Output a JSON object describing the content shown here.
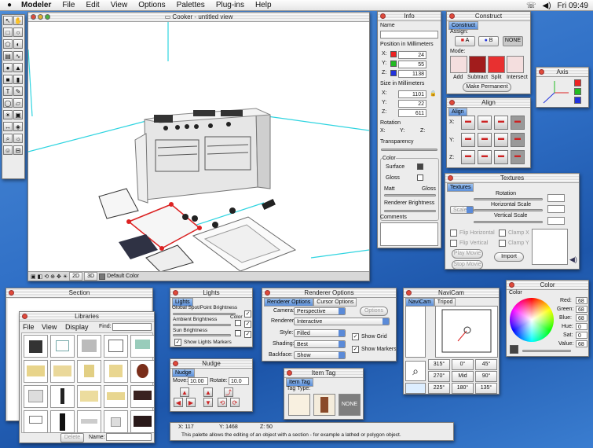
{
  "menubar": {
    "app": "Modeler",
    "items": [
      "File",
      "Edit",
      "View",
      "Options",
      "Palettes",
      "Plug-ins",
      "Help"
    ],
    "clock": "Fri 09:49"
  },
  "main_window": {
    "title": "Cooker - untitled view",
    "bottom_mode": "Default Color",
    "view_btns": [
      "2D",
      "3D"
    ]
  },
  "info": {
    "title": "Info",
    "name_label": "Name",
    "position_label": "Position in Millimeters",
    "x_label": "X:",
    "y_label": "Y:",
    "z_label": "Z:",
    "pos_x": "24",
    "pos_y": "55",
    "pos_z": "1138",
    "size_label": "Size in Millimeters",
    "size_x": "1101",
    "size_y": "22",
    "size_z": "611",
    "rotation_label": "Rotation",
    "rot_x": "X:",
    "rot_y": "Y:",
    "rot_z": "Z:",
    "transparency_label": "Transparency",
    "color_label": "Color",
    "surface_label": "Surface",
    "gloss_label": "Gloss",
    "matt_label": "Matt",
    "gloss2_label": "Gloss",
    "renderer_brightness_label": "Renderer Brightness",
    "comments_label": "Comments"
  },
  "construct": {
    "title": "Construct",
    "tab": "Construct",
    "assign_label": "Assign:",
    "a_label": "A",
    "b_label": "B",
    "none_label": "NONE",
    "mode_label": "Mode:",
    "modes": [
      "Add",
      "Subtract",
      "Split",
      "Intersect"
    ],
    "make_permanent": "Make Permanent"
  },
  "axis": {
    "title": "Axis"
  },
  "align": {
    "title": "Align",
    "tab": "Align",
    "x_label": "X:",
    "y_label": "Y:",
    "z_label": "Z:"
  },
  "textures": {
    "title": "Textures",
    "tab": "Textures",
    "rotation_label": "Rotation",
    "hscale_label": "Horizontal Scale",
    "vscale_label": "Vertical Scale",
    "mode_value": "Scale",
    "flip_h": "Flip Horizontal",
    "flip_v": "Flip Vertical",
    "clamp_x": "Clamp X",
    "clamp_y": "Clamp Y",
    "play_movie": "Play Movie",
    "stop_movie": "Stop Movie",
    "import": "Import"
  },
  "section": {
    "title": "Section"
  },
  "libraries": {
    "title": "Libraries",
    "menu": [
      "File",
      "View",
      "Display"
    ],
    "find_label": "Find:",
    "delete": "Delete",
    "name_label": "Name:"
  },
  "lights": {
    "title": "Lights",
    "tab": "Lights",
    "global_label": "Global Spot/Point Brightness",
    "ambient_label": "Ambient Brightness",
    "color_label": "Color",
    "sun_label": "Sun Brightness",
    "show_markers": "Show Lights Markers"
  },
  "nudge": {
    "title": "Nudge",
    "tab": "Nudge",
    "move_label": "Move:",
    "move_value": "10.00",
    "rotate_label": "Rotate:",
    "rotate_value": "10.0"
  },
  "renderer": {
    "title": "Renderer Options",
    "tabs": [
      "Renderer Options",
      "Cursor Options"
    ],
    "camera_label": "Camera:",
    "camera_value": "Perspective",
    "options_btn": "Options",
    "renderer_label": "Renderer:",
    "renderer_value": "Interactive",
    "style_label": "Style:",
    "style_value": "Filled",
    "shading_label": "Shading:",
    "shading_value": "Best",
    "backface_label": "Backface:",
    "backface_value": "Show",
    "show_grid": "Show Grid",
    "show_markers": "Show Markers"
  },
  "navicam": {
    "title": "NaviCam",
    "tabs": [
      "NaviCam",
      "Tripod"
    ],
    "keys": [
      "315°",
      "0°",
      "45°",
      "270°",
      "Mid",
      "90°",
      "225°",
      "180°",
      "135°"
    ]
  },
  "color": {
    "title": "Color",
    "tab": "Color",
    "red_label": "Red:",
    "red": "68",
    "green_label": "Green:",
    "green": "68",
    "blue_label": "Blue:",
    "blue": "68",
    "hue_label": "Hue:",
    "hue": "0",
    "sat_label": "Sat:",
    "sat": "0",
    "value_label": "Value:",
    "value": "68"
  },
  "itemtag": {
    "title": "Item Tag",
    "tab": "Item Tag",
    "type_label": "Tag Type:",
    "none_label": "NONE"
  },
  "status": {
    "x": "X: 117",
    "y": "Y: 1468",
    "z": "Z: 50",
    "message": "This palette allows the editing of an object with a section - for example a lathed or polygon object."
  }
}
